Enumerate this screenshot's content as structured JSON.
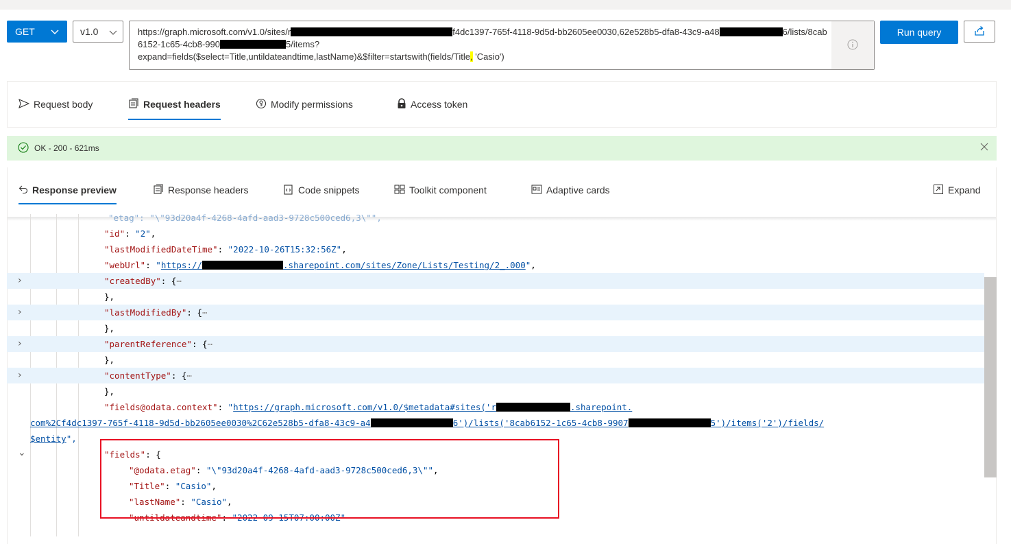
{
  "query": {
    "method": "GET",
    "version": "v1.0",
    "url_seg1": "https://graph.microsoft.com/v1.0/sites/r",
    "url_seg2": "f4dc1397-765f-4118-9d5d-bb2605ee0030,62e528b5-dfa8-43c9-",
    "url_seg3": "a48",
    "url_seg4": "6/lists/8cab6152-1c65-4cb8-990",
    "url_seg5": "5/items?",
    "url_seg6": "expand=fields($select=Title,untildateandtime,lastName)&$filter=startswith(fields/Title",
    "url_seg7": ",",
    "url_seg8": " 'Casio')",
    "run_label": "Run query"
  },
  "request_tabs": [
    "Request body",
    "Request headers",
    "Modify permissions",
    "Access token"
  ],
  "status": {
    "text": "OK - 200 - 621ms"
  },
  "response_tabs": [
    "Response preview",
    "Response headers",
    "Code snippets",
    "Toolkit component",
    "Adaptive cards"
  ],
  "expand_label": "Expand",
  "code": {
    "l0": "\"etag\": \"\\\"93d20a4f-4268-4afd-aad3-9728c500ced6,3\\\"\",",
    "id_key": "\"id\"",
    "id_val": "\"2\"",
    "lmd_key": "\"lastModifiedDateTime\"",
    "lmd_val": "\"2022-10-26T15:32:56Z\"",
    "weburl_key": "\"webUrl\"",
    "weburl_a": "\"",
    "weburl_b": "https://",
    "weburl_c": ".sharepoint.com/sites/Zone/Lists/Testing/2_.000",
    "weburl_d": "\"",
    "created_key": "\"createdBy\"",
    "lmb_key": "\"lastModifiedBy\"",
    "parent_key": "\"parentReference\"",
    "ctype_key": "\"contentType\"",
    "ellipsis": "⋯",
    "ctx_key": "\"fields@odata.context\"",
    "ctx_a": "\"",
    "ctx_b": "https://graph.microsoft.com/v1.0/$metadata#sites('r",
    "ctx_c": ".sharepoint.",
    "ctx_d": "com%2Cf4dc1397-765f-4118-9d5d-bb2605ee0030%2C62e528b5-dfa8-43c9-a4",
    "ctx_e": "6')/lists('8cab6152-1c65-4cb8-9907",
    "ctx_f": "5')/items('2')/fields/",
    "ctx_g": "$entity",
    "ctx_h": "\",",
    "fields_key": "\"fields\"",
    "etag_key": "\"@odata.etag\"",
    "etag_val": "\"\\\"93d20a4f-4268-4afd-aad3-9728c500ced6,3\\\"\"",
    "title_key": "\"Title\"",
    "title_val": "\"Casio\"",
    "lastname_key": "\"lastName\"",
    "lastname_val": "\"Casio\"",
    "until_key": "\"untildateandtime\"",
    "until_val": "\"2022-09-15T07:00:00Z\""
  },
  "colors": {
    "accent": "#0078d4",
    "success_bg": "#dff6dd",
    "highlight_box": "#e81123"
  }
}
